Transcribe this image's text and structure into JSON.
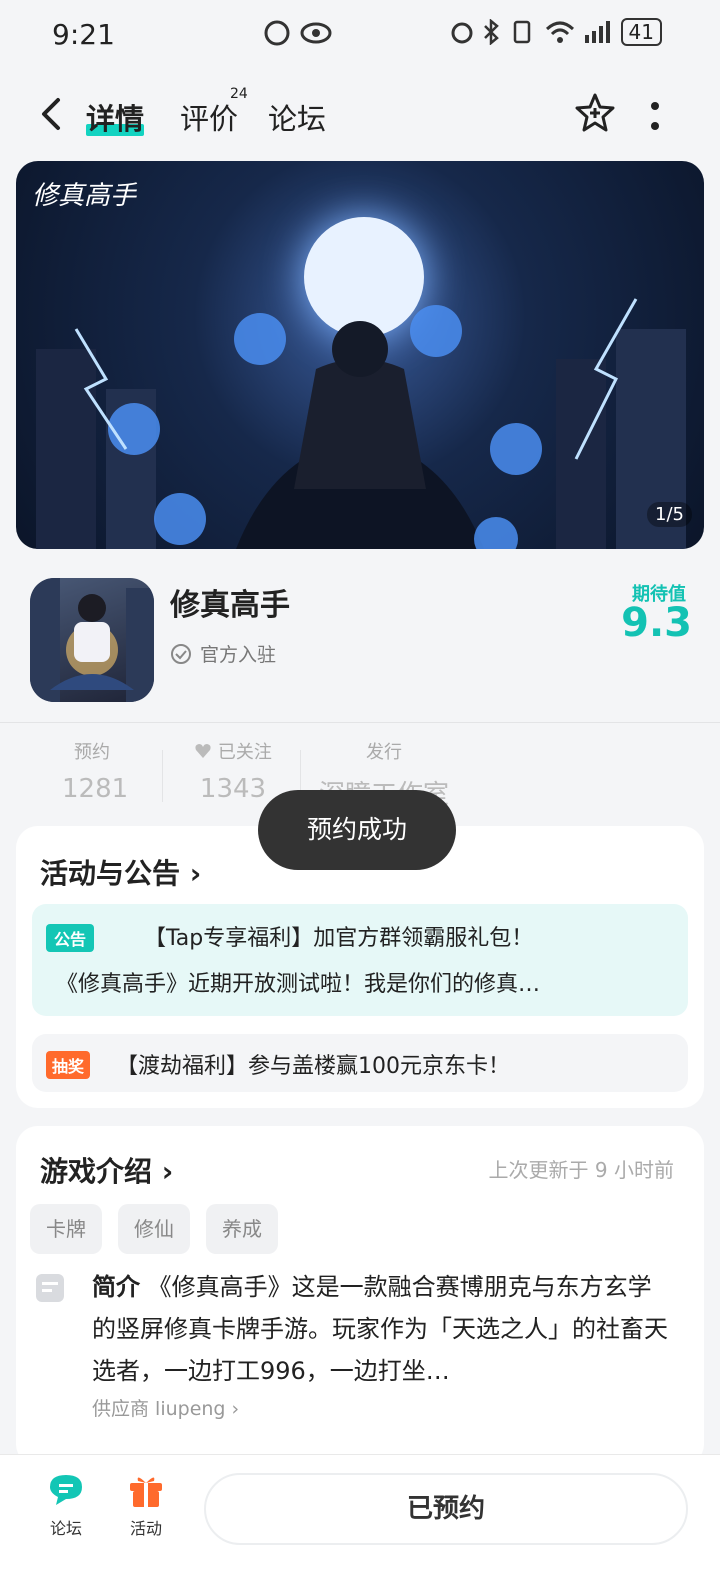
{
  "status_bar": {
    "time": "9:21",
    "battery": "41"
  },
  "nav": {
    "tabs": {
      "details": "详情",
      "reviews": "评价",
      "reviews_count": "24",
      "forum": "论坛"
    }
  },
  "banner": {
    "logo_text": "修真高手",
    "counter": "1/5"
  },
  "app": {
    "name": "修真高手",
    "official_badge": "官方入驻",
    "expect_label": "期待值",
    "expect_score": "9.3"
  },
  "stats": [
    {
      "label": "预约",
      "value": "1281"
    },
    {
      "label": "已关注",
      "value": "1343"
    },
    {
      "label": "发行",
      "value": "深瞳工作室"
    }
  ],
  "toast": "预约成功",
  "activities": {
    "title": "活动与公告",
    "notice": {
      "tag": "公告",
      "line1": "【Tap专享福利】加官方群领霸服礼包！",
      "line2": "《修真高手》近期开放测试啦！我是你们的修真…"
    },
    "lottery": {
      "tag": "抽奖",
      "text": "【渡劫福利】参与盖楼赢100元京东卡！"
    }
  },
  "intro": {
    "title": "游戏介绍",
    "updated": "上次更新于 9 小时前",
    "tags": [
      "卡牌",
      "修仙",
      "养成"
    ],
    "summary_label": "简介",
    "summary": "《修真高手》这是一款融合赛博朋克与东方玄学的竖屏修真卡牌手游。玩家作为「天选之人」的社畜天选者，一边打工996，一边打坐…",
    "supplier": "供应商 liupeng"
  },
  "bottom_bar": {
    "forum_label": "论坛",
    "activity_label": "活动",
    "reserve_label": "已预约"
  },
  "colors": {
    "accent": "#13d3c1",
    "orange": "#ff6a2c"
  }
}
